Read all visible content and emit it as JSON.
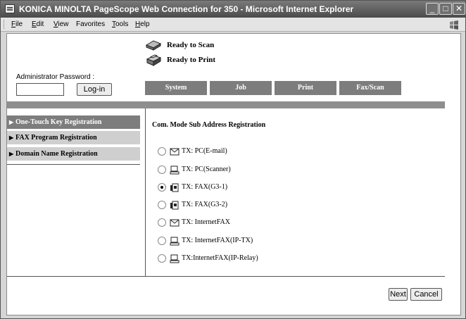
{
  "window": {
    "title": "KONICA MINOLTA PageScope Web Connection for 350 - Microsoft Internet Explorer",
    "controls": {
      "minimize": "_",
      "maximize": "□",
      "close": "✕"
    }
  },
  "menu": [
    {
      "underline": "F",
      "rest": "ile"
    },
    {
      "underline": "E",
      "rest": "dit"
    },
    {
      "underline": "V",
      "rest": "iew"
    },
    {
      "underline": "F",
      "rest": "a",
      "full": "Favorites"
    },
    {
      "underline": "T",
      "rest": "ools"
    },
    {
      "underline": "H",
      "rest": "elp"
    }
  ],
  "menu_labels": [
    "File",
    "Edit",
    "View",
    "Favorites",
    "Tools",
    "Help"
  ],
  "status": {
    "scan": "Ready to Scan",
    "print": "Ready to Print"
  },
  "admin": {
    "label": "Administrator Password :",
    "value": "",
    "login_label": "Log-in"
  },
  "tabs": [
    "System",
    "Job",
    "Print",
    "Fax/Scan"
  ],
  "sidebar": {
    "items": [
      {
        "label": "One-Touch Key Registration",
        "active": true
      },
      {
        "label": "FAX Program Registration",
        "active": false
      },
      {
        "label": "Domain Name Registration",
        "active": false
      }
    ]
  },
  "main": {
    "title": "Com. Mode Sub Address Registration",
    "options": [
      {
        "label": "TX: PC(E-mail)",
        "icon": "envelope-icon",
        "checked": false
      },
      {
        "label": "TX: PC(Scanner)",
        "icon": "computer-icon",
        "checked": false
      },
      {
        "label": "TX: FAX(G3-1)",
        "icon": "fax-icon",
        "checked": true
      },
      {
        "label": "TX: FAX(G3-2)",
        "icon": "fax-icon",
        "checked": false
      },
      {
        "label": "TX: InternetFAX",
        "icon": "envelope-icon",
        "checked": false
      },
      {
        "label": "TX: InternetFAX(IP-TX)",
        "icon": "computer-icon",
        "checked": false
      },
      {
        "label": "TX:InternetFAX(IP-Relay)",
        "icon": "computer-icon",
        "checked": false
      }
    ]
  },
  "footer": {
    "next_label": "Next",
    "cancel_label": "Cancel"
  }
}
